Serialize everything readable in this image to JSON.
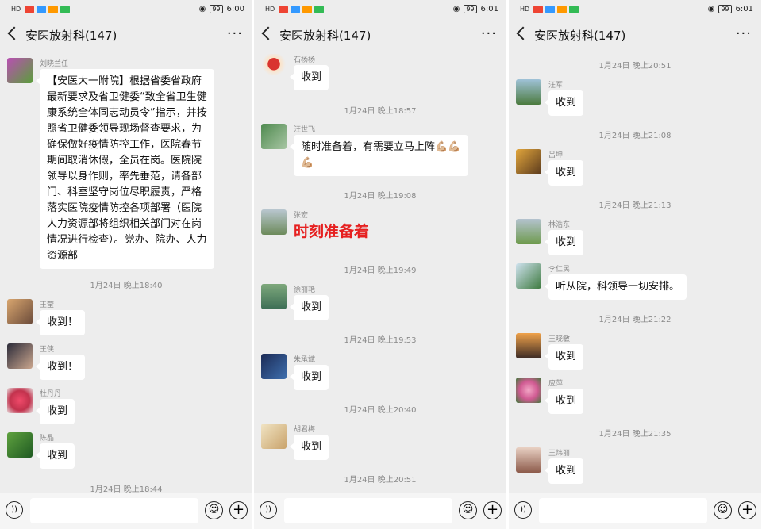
{
  "panels": [
    {
      "status": {
        "signal": "HD",
        "battery": "99",
        "time": "6:00"
      },
      "header": {
        "title": "安医放射科(147)",
        "more": "···"
      },
      "messages": [
        {
          "kind": "msg",
          "sender": "刘晓兰任",
          "text": "【安医大一附院】根据省委省政府最新要求及省卫健委“致全省卫生健康系统全体同志动员令”指示，并按照省卫健委领导现场督查要求，为确保做好疫情防控工作，医院春节期间取消休假，全员在岗。医院院领导以身作则，率先垂范，请各部门、科室坚守岗位尽职履责，严格落实医院疫情防控各项部署（医院人力资源部将组织相关部门对在岗情况进行检查）。党办、院办、人力资源部"
        },
        {
          "kind": "ts",
          "text": "1月24日 晚上18:40"
        },
        {
          "kind": "msg",
          "sender": "王莹",
          "text": "收到！"
        },
        {
          "kind": "msg",
          "sender": "王侠",
          "text": "收到！"
        },
        {
          "kind": "msg",
          "sender": "杜丹丹",
          "text": "收到"
        },
        {
          "kind": "msg",
          "sender": "陈晶",
          "text": "收到"
        },
        {
          "kind": "ts",
          "text": "1月24日 晚上18:44"
        }
      ]
    },
    {
      "status": {
        "signal": "HD",
        "battery": "99",
        "time": "6:01"
      },
      "header": {
        "title": "安医放射科(147)",
        "more": "···"
      },
      "messages": [
        {
          "kind": "msg",
          "sender": "石杨杨",
          "text": "收到"
        },
        {
          "kind": "ts",
          "text": "1月24日 晚上18:57"
        },
        {
          "kind": "msg",
          "sender": "汪世飞",
          "text": "随时准备着，有需要立马上阵💪🏼💪🏼💪🏼"
        },
        {
          "kind": "ts",
          "text": "1月24日 晚上19:08"
        },
        {
          "kind": "msg",
          "sender": "张宏",
          "text": "时刻准备着",
          "plain": true
        },
        {
          "kind": "ts",
          "text": "1月24日 晚上19:49"
        },
        {
          "kind": "msg",
          "sender": "徐丽艳",
          "text": "收到"
        },
        {
          "kind": "ts",
          "text": "1月24日 晚上19:53"
        },
        {
          "kind": "msg",
          "sender": "朱承斌",
          "text": "收到"
        },
        {
          "kind": "ts",
          "text": "1月24日 晚上20:40"
        },
        {
          "kind": "msg",
          "sender": "胡君梅",
          "text": "收到"
        },
        {
          "kind": "ts",
          "text": "1月24日 晚上20:51"
        }
      ]
    },
    {
      "status": {
        "signal": "HD",
        "battery": "99",
        "time": "6:01"
      },
      "header": {
        "title": "安医放射科(147)",
        "more": "···"
      },
      "messages": [
        {
          "kind": "ts",
          "text": "1月24日 晚上20:51"
        },
        {
          "kind": "msg",
          "sender": "汪军",
          "text": "收到"
        },
        {
          "kind": "ts",
          "text": "1月24日 晚上21:08"
        },
        {
          "kind": "msg",
          "sender": "吕坤",
          "text": "收到"
        },
        {
          "kind": "ts",
          "text": "1月24日 晚上21:13"
        },
        {
          "kind": "msg",
          "sender": "林浩东",
          "text": "收到"
        },
        {
          "kind": "msg",
          "sender": "李仁民",
          "text": "听从院，科领导一切安排。"
        },
        {
          "kind": "ts",
          "text": "1月24日 晚上21:22"
        },
        {
          "kind": "msg",
          "sender": "王晓敏",
          "text": "收到"
        },
        {
          "kind": "msg",
          "sender": "应萍",
          "text": "收到"
        },
        {
          "kind": "ts",
          "text": "1月24日 晚上21:35"
        },
        {
          "kind": "msg",
          "sender": "王炜丽",
          "text": "收到"
        }
      ]
    }
  ],
  "colors": {
    "background": "#ededed",
    "bubble": "#ffffff",
    "timestamp": "#8a8a8a",
    "highlight_text": "#e62020"
  }
}
